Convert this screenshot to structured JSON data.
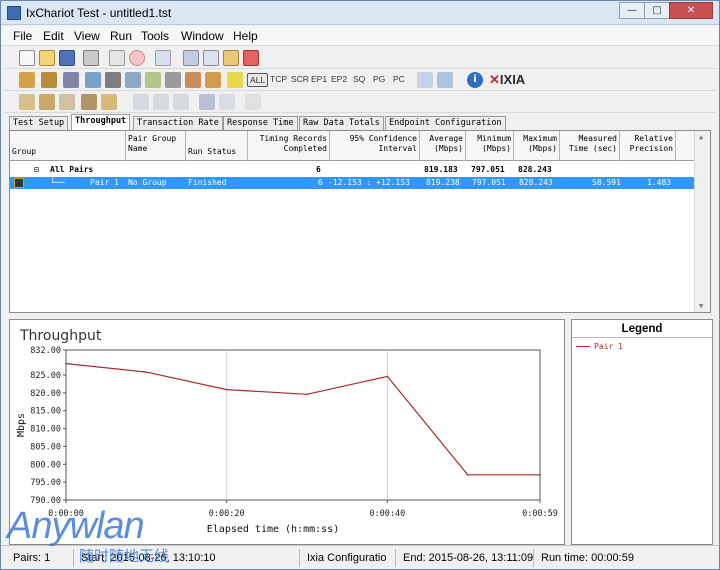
{
  "window": {
    "title": "IxChariot Test - untitled1.tst",
    "minimize": "—",
    "maximize": "□",
    "close": "✕"
  },
  "menu": [
    "File",
    "Edit",
    "View",
    "Run",
    "Tools",
    "Window",
    "Help"
  ],
  "toolbar2_text": [
    "ALL",
    "TCP",
    "SCR",
    "EP1",
    "EP2",
    "SQ",
    "PG",
    "PC"
  ],
  "toolbar2_logo": "IXIA",
  "tabs": [
    {
      "label": "Test Setup",
      "active": false
    },
    {
      "label": "Throughput",
      "active": true
    },
    {
      "label": "Transaction Rate",
      "active": false
    },
    {
      "label": "Response Time",
      "active": false
    },
    {
      "label": "Raw Data Totals",
      "active": false
    },
    {
      "label": "Endpoint Configuration",
      "active": false
    }
  ],
  "grid": {
    "headers": [
      "Group",
      "Pair Group\nName",
      "Run Status",
      "Timing Records\nCompleted",
      "95% Confidence\nInterval",
      "Average\n(Mbps)",
      "Minimum\n(Mbps)",
      "Maximum\n(Mbps)",
      "Measured\nTime (sec)",
      "Relative\nPrecision"
    ],
    "group_row": {
      "expander": "⊟",
      "label": "All Pairs",
      "records": "6",
      "average": "819.183",
      "minimum": "797.051",
      "maximum": "828.243"
    },
    "pair_row": {
      "pair": "Pair 1",
      "group_name": "No Group",
      "status": "Finished",
      "records": "6",
      "ci": "-12.153 : +12.153",
      "average": "819.238",
      "minimum": "797.051",
      "maximum": "828.243",
      "time": "58.591",
      "precision": "1.483"
    }
  },
  "chart_data": {
    "type": "line",
    "title": "Throughput",
    "xlabel": "Elapsed time (h:mm:ss)",
    "ylabel": "Mbps",
    "ylim": [
      790,
      832
    ],
    "yticks": [
      "832.00",
      "825.00",
      "820.00",
      "815.00",
      "810.00",
      "805.00",
      "800.00",
      "795.00",
      "790.00"
    ],
    "ytick_values": [
      832,
      825,
      820,
      815,
      810,
      805,
      800,
      795,
      790
    ],
    "xlim": [
      0,
      59
    ],
    "xticks": [
      "0:00:00",
      "0:00:20",
      "0:00:40",
      "0:00:59"
    ],
    "xtick_values": [
      0,
      20,
      40,
      59
    ],
    "grid": true,
    "series": [
      {
        "name": "Pair 1",
        "color": "#aa2a2a",
        "x": [
          0,
          10,
          20,
          30,
          40,
          50,
          59
        ],
        "values": [
          828.2,
          825.8,
          820.9,
          819.6,
          824.6,
          797.05,
          797.05
        ]
      }
    ]
  },
  "legend": {
    "title": "Legend",
    "items": [
      "Pair 1"
    ]
  },
  "status": {
    "pairs": "Pairs: 1",
    "start": "Start: 2015-08-26, 13:10:10",
    "config": "Ixia Configuratio",
    "end": "End: 2015-08-26, 13:11:09",
    "runtime": "Run time: 00:00:59"
  },
  "watermark": {
    "brand": "Anywlan",
    "caption": "随时随地无线"
  }
}
